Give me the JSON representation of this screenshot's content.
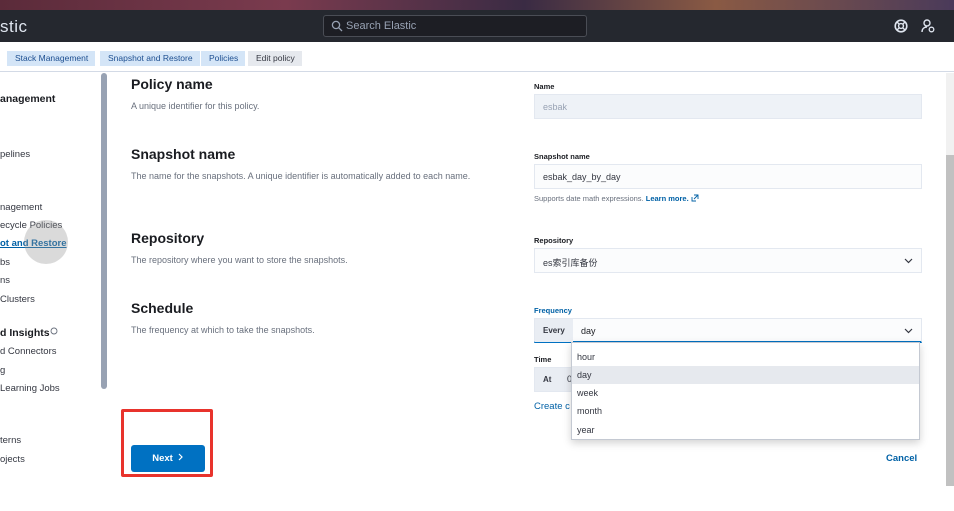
{
  "header": {
    "brand": "stic",
    "search_placeholder": "Search Elastic",
    "icons": [
      "search-icon",
      "help-icon",
      "user-settings-icon"
    ]
  },
  "breadcrumbs": [
    "Stack Management",
    "Snapshot and Restore",
    "Policies",
    "Edit policy"
  ],
  "sidebar": {
    "items": [
      {
        "label": "anagement",
        "kind": "heading"
      },
      {
        "label": "pelines",
        "kind": "item"
      },
      {
        "label": "nagement",
        "kind": "item"
      },
      {
        "label": "ecycle Policies",
        "kind": "item"
      },
      {
        "label": "ot and Restore",
        "kind": "active"
      },
      {
        "label": "bs",
        "kind": "item"
      },
      {
        "label": "ns",
        "kind": "item"
      },
      {
        "label": "Clusters",
        "kind": "item"
      },
      {
        "label": "d Insights",
        "kind": "heading"
      },
      {
        "label": "d Connectors",
        "kind": "item"
      },
      {
        "label": "g",
        "kind": "item"
      },
      {
        "label": "Learning Jobs",
        "kind": "item"
      },
      {
        "label": "terns",
        "kind": "item"
      },
      {
        "label": "ojects",
        "kind": "item"
      }
    ]
  },
  "form": {
    "policy_name": {
      "title": "Policy name",
      "description": "A unique identifier for this policy.",
      "label": "Name",
      "value": "esbak"
    },
    "snapshot_name": {
      "title": "Snapshot name",
      "description": "The name for the snapshots. A unique identifier is automatically added to each name.",
      "label": "Snapshot name",
      "value": "esbak_day_by_day",
      "help": "Supports date math expressions.",
      "help_link": "Learn more."
    },
    "repository": {
      "title": "Repository",
      "description": "The repository where you want to store the snapshots.",
      "label": "Repository",
      "value": "es索引库备份"
    },
    "schedule": {
      "title": "Schedule",
      "description": "The frequency at which to take the snapshots.",
      "frequency_label": "Frequency",
      "every_label": "Every",
      "frequency_value": "day",
      "options": [
        "hour",
        "day",
        "week",
        "month",
        "year"
      ],
      "selected_option": "day",
      "time_label": "Time",
      "at_label": "At",
      "time_value": "0",
      "create_link": "Create c"
    }
  },
  "actions": {
    "next_label": "Next",
    "cancel_label": "Cancel"
  },
  "colors": {
    "accent": "#0071c2",
    "header_bg": "#25282f",
    "highlight_box": "#e8332c"
  }
}
